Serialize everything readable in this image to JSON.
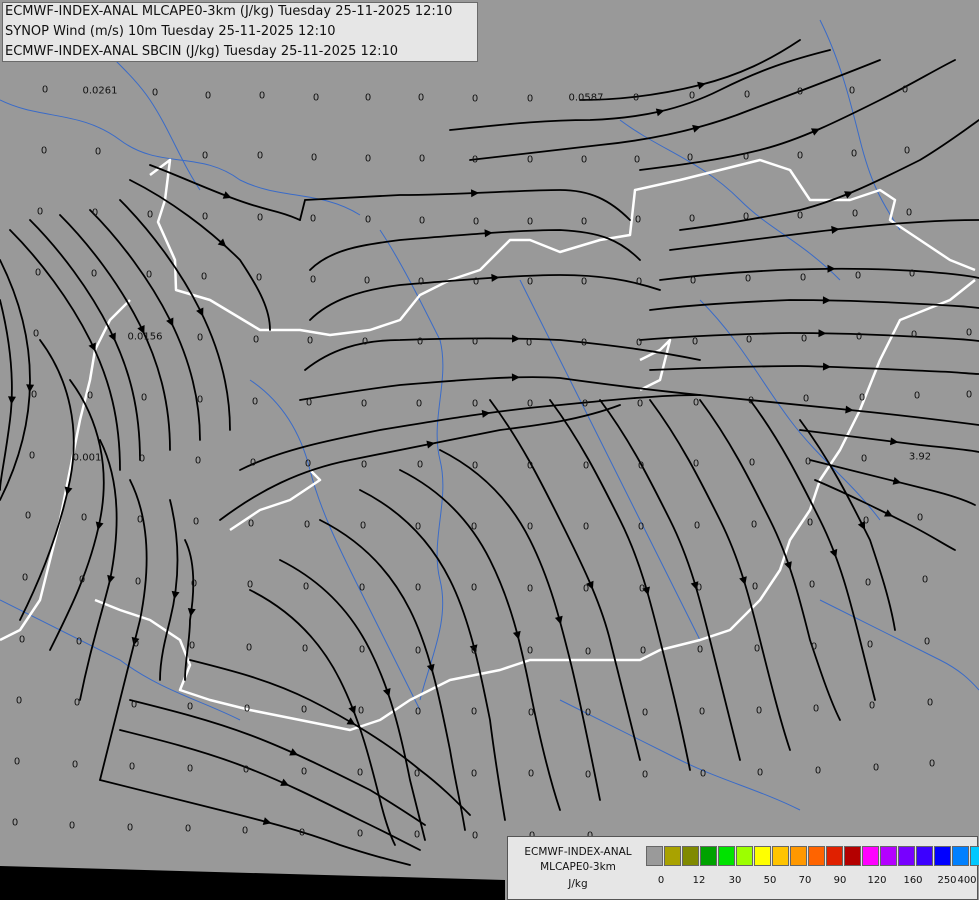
{
  "header": {
    "line1": "ECMWF-INDEX-ANAL MLCAPE0-3km (J/kg) Tuesday 25-11-2025 12:10",
    "line2": "SYNOP Wind (m/s) 10m Tuesday 25-11-2025 12:10",
    "line3": "ECMWF-INDEX-ANAL SBCIN (J/kg) Tuesday 25-11-2025 12:10"
  },
  "legend": {
    "title1": "ECMWF-INDEX-ANAL",
    "title2": "MLCAPE0-3km",
    "title3": "J/kg",
    "swatch_colors": [
      "#9a9a9a",
      "#a9a200",
      "#808a00",
      "#00a200",
      "#00e300",
      "#9cff00",
      "#ffff00",
      "#ffc400",
      "#ff9800",
      "#ff6400",
      "#e02000",
      "#b40000",
      "#ff00ff",
      "#b400ff",
      "#7800ff",
      "#3c00ff",
      "#0000ff",
      "#0080ff",
      "#00c8ff",
      "#00ffff",
      "#a0ffff",
      "#ffffff"
    ],
    "ticks": [
      "0",
      "12",
      "30",
      "50",
      "70",
      "90",
      "120",
      "160",
      "250",
      "400"
    ]
  },
  "colors": {
    "background": "#999999",
    "border": "#ffffff",
    "rivers": "#3a6bc8",
    "streamlines": "#000000",
    "no_data": "#000000"
  },
  "grid_labels": [
    {
      "text": "0.0261"
    },
    {
      "text": "0.0587"
    },
    {
      "text": "0.0156"
    },
    {
      "text": "0.001"
    },
    {
      "text": "3.92"
    },
    {
      "text": "0"
    },
    {
      "text": "0"
    },
    {
      "text": "0"
    },
    {
      "text": "0"
    },
    {
      "text": "0"
    },
    {
      "text": "0"
    },
    {
      "text": "0"
    },
    {
      "text": "0"
    },
    {
      "text": "0"
    },
    {
      "text": "0"
    },
    {
      "text": "0"
    },
    {
      "text": "0"
    },
    {
      "text": "0"
    },
    {
      "text": "0"
    },
    {
      "text": "0"
    },
    {
      "text": "0"
    },
    {
      "text": "0"
    },
    {
      "text": "0"
    },
    {
      "text": "0"
    },
    {
      "text": "0"
    },
    {
      "text": "0"
    },
    {
      "text": "0"
    },
    {
      "text": "0"
    },
    {
      "text": "0"
    },
    {
      "text": "0"
    },
    {
      "text": "0"
    },
    {
      "text": "0"
    },
    {
      "text": "0"
    },
    {
      "text": "0"
    },
    {
      "text": "0"
    },
    {
      "text": "0"
    },
    {
      "text": "0"
    },
    {
      "text": "0"
    },
    {
      "text": "0"
    },
    {
      "text": "0"
    },
    {
      "text": "0"
    },
    {
      "text": "0"
    },
    {
      "text": "0"
    },
    {
      "text": "0"
    },
    {
      "text": "0"
    },
    {
      "text": "0"
    },
    {
      "text": "0"
    },
    {
      "text": "0"
    },
    {
      "text": "0"
    },
    {
      "text": "0"
    },
    {
      "text": "0"
    },
    {
      "text": "0"
    },
    {
      "text": "0"
    },
    {
      "text": "0"
    },
    {
      "text": "0"
    },
    {
      "text": "0"
    },
    {
      "text": "0"
    },
    {
      "text": "0"
    },
    {
      "text": "0"
    },
    {
      "text": "0"
    },
    {
      "text": "0"
    },
    {
      "text": "0"
    },
    {
      "text": "0"
    },
    {
      "text": "0"
    },
    {
      "text": "0"
    },
    {
      "text": "0"
    },
    {
      "text": "0"
    },
    {
      "text": "0"
    },
    {
      "text": "0"
    },
    {
      "text": "0"
    },
    {
      "text": "0"
    },
    {
      "text": "0"
    },
    {
      "text": "0"
    },
    {
      "text": "0"
    },
    {
      "text": "0"
    },
    {
      "text": "0"
    },
    {
      "text": "0"
    },
    {
      "text": "0"
    },
    {
      "text": "0"
    },
    {
      "text": "0"
    },
    {
      "text": "0"
    },
    {
      "text": "0"
    },
    {
      "text": "0"
    },
    {
      "text": "0"
    },
    {
      "text": "0"
    },
    {
      "text": "0"
    },
    {
      "text": "0"
    },
    {
      "text": "0"
    },
    {
      "text": "0"
    },
    {
      "text": "0"
    },
    {
      "text": "0"
    },
    {
      "text": "0"
    },
    {
      "text": "0"
    },
    {
      "text": "0"
    },
    {
      "text": "0"
    },
    {
      "text": "0"
    },
    {
      "text": "0"
    },
    {
      "text": "0"
    },
    {
      "text": "0"
    },
    {
      "text": "0"
    },
    {
      "text": "0"
    },
    {
      "text": "0"
    },
    {
      "text": "0"
    },
    {
      "text": "0"
    },
    {
      "text": "0"
    },
    {
      "text": "0"
    },
    {
      "text": "0"
    },
    {
      "text": "0"
    },
    {
      "text": "0"
    },
    {
      "text": "0"
    },
    {
      "text": "0"
    },
    {
      "text": "0"
    },
    {
      "text": "0"
    },
    {
      "text": "0"
    },
    {
      "text": "0"
    },
    {
      "text": "0"
    },
    {
      "text": "0"
    },
    {
      "text": "0"
    },
    {
      "text": "0"
    },
    {
      "text": "0"
    },
    {
      "text": "0"
    },
    {
      "text": "0"
    },
    {
      "text": "0"
    },
    {
      "text": "0"
    },
    {
      "text": "0"
    },
    {
      "text": "0"
    },
    {
      "text": "0"
    },
    {
      "text": "0"
    },
    {
      "text": "0"
    },
    {
      "text": "0"
    },
    {
      "text": "0"
    },
    {
      "text": "0"
    },
    {
      "text": "0"
    },
    {
      "text": "0"
    },
    {
      "text": "0"
    },
    {
      "text": "0"
    },
    {
      "text": "0"
    },
    {
      "text": "0"
    },
    {
      "text": "0"
    },
    {
      "text": "0"
    },
    {
      "text": "0"
    },
    {
      "text": "0"
    },
    {
      "text": "0"
    },
    {
      "text": "0"
    },
    {
      "text": "0"
    },
    {
      "text": "0"
    },
    {
      "text": "0"
    },
    {
      "text": "0"
    },
    {
      "text": "0"
    },
    {
      "text": "0"
    },
    {
      "text": "0"
    },
    {
      "text": "0"
    },
    {
      "text": "0"
    },
    {
      "text": "0"
    },
    {
      "text": "0"
    },
    {
      "text": "0"
    },
    {
      "text": "0"
    },
    {
      "text": "0"
    },
    {
      "text": "0"
    },
    {
      "text": "0"
    },
    {
      "text": "0"
    },
    {
      "text": "0"
    },
    {
      "text": "0"
    },
    {
      "text": "0"
    },
    {
      "text": "0"
    },
    {
      "text": "0"
    },
    {
      "text": "0"
    },
    {
      "text": "0"
    },
    {
      "text": "0"
    },
    {
      "text": "0"
    },
    {
      "text": "0"
    },
    {
      "text": "0"
    },
    {
      "text": "0"
    },
    {
      "text": "0"
    },
    {
      "text": "0"
    },
    {
      "text": "0"
    },
    {
      "text": "0"
    },
    {
      "text": "0"
    },
    {
      "text": "0"
    },
    {
      "text": "0"
    },
    {
      "text": "0"
    },
    {
      "text": "0"
    },
    {
      "text": "0"
    },
    {
      "text": "0"
    },
    {
      "text": "0"
    },
    {
      "text": "0"
    },
    {
      "text": "0"
    },
    {
      "text": "0"
    },
    {
      "text": "0"
    },
    {
      "text": "0"
    },
    {
      "text": "0"
    },
    {
      "text": "0"
    },
    {
      "text": "0"
    },
    {
      "text": "0"
    },
    {
      "text": "0"
    },
    {
      "text": "0"
    },
    {
      "text": "0"
    },
    {
      "text": "0"
    },
    {
      "text": "0"
    },
    {
      "text": "0"
    },
    {
      "text": "0"
    },
    {
      "text": "0"
    },
    {
      "text": "0"
    },
    {
      "text": "0"
    },
    {
      "text": "0"
    },
    {
      "text": "0"
    },
    {
      "text": "0"
    },
    {
      "text": "0"
    },
    {
      "text": "0"
    },
    {
      "text": "0"
    },
    {
      "text": "0"
    },
    {
      "text": "0"
    },
    {
      "text": "0"
    },
    {
      "text": "0"
    },
    {
      "text": "0"
    }
  ]
}
